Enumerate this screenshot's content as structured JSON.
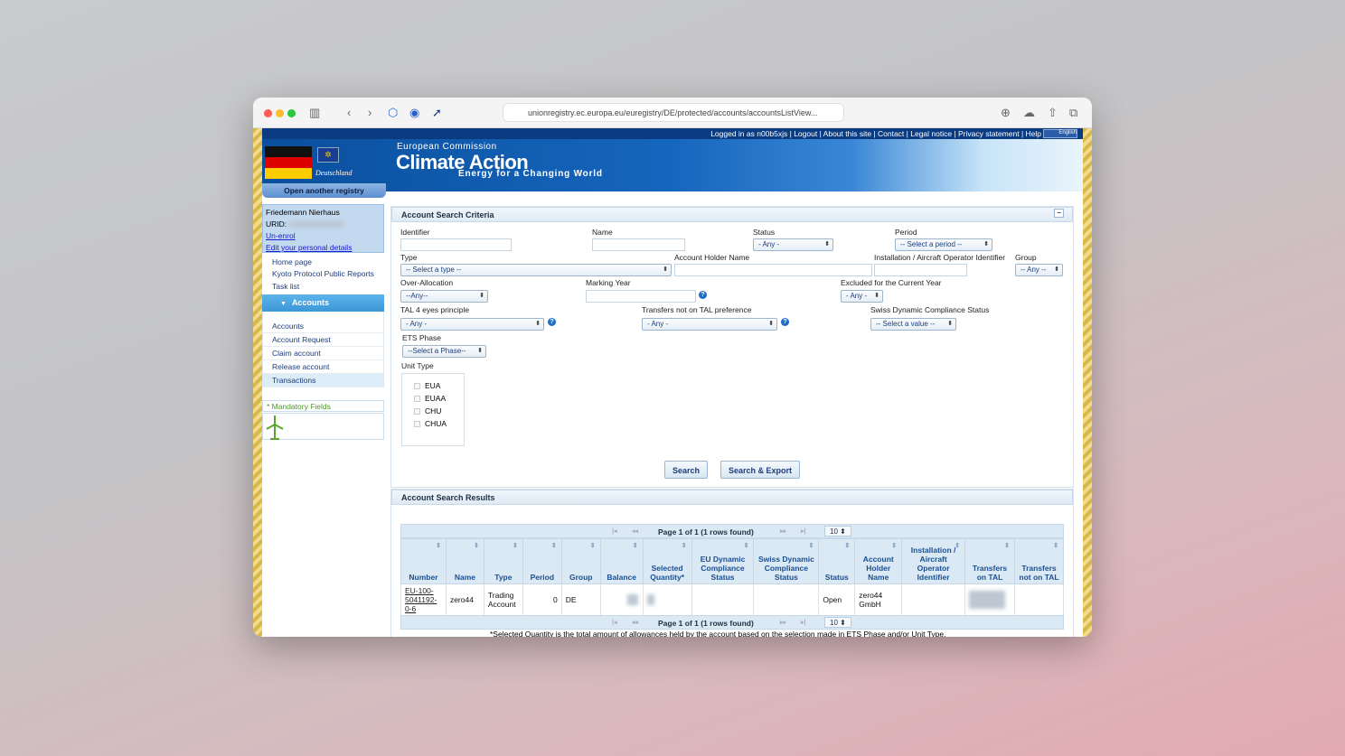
{
  "browser": {
    "url": "unionregistry.ec.europa.eu/euregistry/DE/protected/accounts/accountsListView..."
  },
  "topbar": {
    "links": [
      "Logged in as n00b5xjs",
      "Logout",
      "About this site",
      "Contact",
      "Legal notice",
      "Privacy statement",
      "Help"
    ],
    "language": "English"
  },
  "banner": {
    "country": "Deutschland",
    "org": "European Commission",
    "title": "Climate Action",
    "tagline": "Energy for a Changing World"
  },
  "sidebar": {
    "open_registry": "Open another registry",
    "user_name": "Friedemann Nierhaus",
    "urid_label": "URID:",
    "unenrol": "Un-enrol",
    "edit_details": "Edit your personal details",
    "nav": [
      "Home page",
      "Kyoto Protocol Public Reports",
      "Task list"
    ],
    "accounts_header": "Accounts",
    "accounts_items": [
      "Accounts",
      "Account Request",
      "Claim account",
      "Release account",
      "Transactions"
    ],
    "mandatory": "Mandatory Fields"
  },
  "criteria": {
    "title": "Account Search Criteria",
    "collapse": "−",
    "identifier": "Identifier",
    "name": "Name",
    "status": "Status",
    "status_value": "- Any -",
    "period": "Period",
    "period_value": "-- Select a period --",
    "type": "Type",
    "type_value": "-- Select a type --",
    "holder": "Account Holder Name",
    "installation": "Installation / Aircraft Operator Identifier",
    "group": "Group",
    "group_value": "-- Any --",
    "over_allocation": "Over-Allocation",
    "over_allocation_value": "--Any--",
    "marking_year": "Marking Year",
    "excluded": "Excluded for the Current Year",
    "excluded_value": "- Any -",
    "tal4": "TAL 4 eyes principle",
    "tal4_value": "- Any -",
    "not_tal": "Transfers not on TAL preference",
    "not_tal_value": "- Any -",
    "swiss": "Swiss Dynamic Compliance Status",
    "swiss_value": "-- Select a value --",
    "ets": "ETS Phase",
    "ets_value": "--Select a Phase--",
    "unit_type": "Unit Type",
    "units": [
      "EUA",
      "EUAA",
      "CHU",
      "CHUA"
    ],
    "search": "Search",
    "search_export": "Search & Export",
    "help": "?"
  },
  "results": {
    "title": "Account Search Results",
    "pager": "Page 1 of 1 (1 rows found)",
    "page_size": "10",
    "columns": [
      "Number",
      "Name",
      "Type",
      "Period",
      "Group",
      "Balance",
      "Selected Quantity*",
      "EU Dynamic Compliance Status",
      "Swiss Dynamic Compliance Status",
      "Status",
      "Account Holder Name",
      "Installation / Aircraft Operator Identifier",
      "Transfers on TAL",
      "Transfers not on TAL"
    ],
    "rows": [
      {
        "number": "EU-100-5041192-0-6",
        "name": "zero44",
        "type": "Trading Account",
        "period": "0",
        "group": "DE",
        "status": "Open",
        "holder": "zero44 GmbH"
      }
    ],
    "footnote": "*Selected Quantity is the total amount of allowances held by the account based on the selection made in ETS Phase and/or Unit Type."
  }
}
